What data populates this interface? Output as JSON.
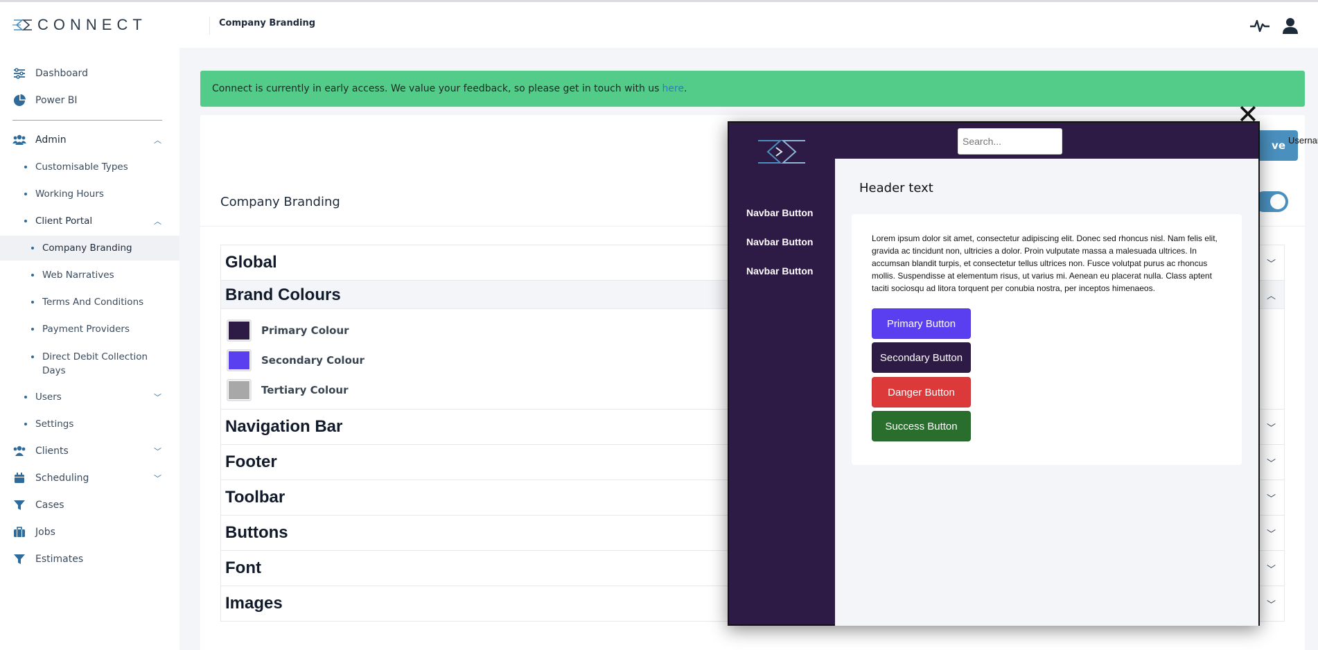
{
  "app": {
    "logo_text": "CONNECT"
  },
  "sidebar": {
    "items": [
      {
        "label": "Dashboard",
        "icon": "sliders-icon"
      },
      {
        "label": "Power BI",
        "icon": "pie-chart-icon"
      },
      {
        "label": "Admin",
        "icon": "users-icon"
      },
      {
        "label": "Customisable Types"
      },
      {
        "label": "Working Hours"
      },
      {
        "label": "Client Portal"
      },
      {
        "label": "Company Branding"
      },
      {
        "label": "Web Narratives"
      },
      {
        "label": "Terms And Conditions"
      },
      {
        "label": "Payment Providers"
      },
      {
        "label": "Direct Debit Collection Days"
      },
      {
        "label": "Users"
      },
      {
        "label": "Settings"
      },
      {
        "label": "Clients",
        "icon": "users-icon"
      },
      {
        "label": "Scheduling",
        "icon": "calendar-icon"
      },
      {
        "label": "Cases",
        "icon": "filter-icon"
      },
      {
        "label": "Jobs",
        "icon": "briefcase-icon"
      },
      {
        "label": "Estimates",
        "icon": "filter-icon"
      }
    ]
  },
  "header": {
    "title": "Company Branding"
  },
  "banner": {
    "text": "Connect is currently in early access. We value your feedback, so please get in touch with us",
    "link": "here",
    "end": "."
  },
  "main": {
    "title": "Company Branding",
    "save_label": "ve",
    "sections": [
      "Global",
      "Brand Colours",
      "Navigation Bar",
      "Footer",
      "Toolbar",
      "Buttons",
      "Font",
      "Images"
    ],
    "colours": [
      {
        "label": "Primary Colour",
        "color": "#2d1a45"
      },
      {
        "label": "Secondary Colour",
        "color": "#5a3ff0"
      },
      {
        "label": "Tertiary Colour",
        "color": "#a8a8a8"
      }
    ]
  },
  "preview": {
    "close": "✕",
    "search_placeholder": "Search...",
    "username": "Username",
    "nav_buttons": [
      "Navbar Button",
      "Navbar Button",
      "Navbar Button"
    ],
    "header_text": "Header text",
    "lorem": "Lorem ipsum dolor sit amet, consectetur adipiscing elit. Donec sed rhoncus nisl. Nam felis elit, gravida ac tincidunt non, ultricies a dolor. Proin vulputate massa a malesuada ultrices. In accumsan blandit turpis, et consectetur tellus ultrices non. Fusce volutpat purus ac rhoncus mollis. Suspendisse at elementum risus, ut varius mi. Aenean eu placerat nulla. Class aptent taciti sociosqu ad litora torquent per conubia nostra, per inceptos himenaeos.",
    "buttons": [
      {
        "label": "Primary Button",
        "color": "#5a3ff0"
      },
      {
        "label": "Secondary Button",
        "color": "#2d1a45"
      },
      {
        "label": "Danger Button",
        "color": "#dc3a3a"
      },
      {
        "label": "Success Button",
        "color": "#2a6e2e"
      }
    ]
  }
}
